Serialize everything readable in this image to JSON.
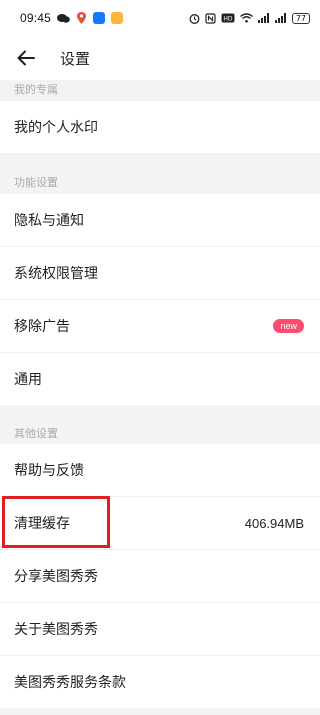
{
  "status_bar": {
    "time": "09:45",
    "battery": "77"
  },
  "header": {
    "title": "设置"
  },
  "sections": {
    "my_exclusive": "我的专属",
    "features": "功能设置",
    "others": "其他设置"
  },
  "rows": {
    "watermark": "我的个人水印",
    "privacy": "隐私与通知",
    "permissions": "系统权限管理",
    "remove_ads": "移除广告",
    "remove_ads_badge": "new",
    "general": "通用",
    "help": "帮助与反馈",
    "clear_cache": "清理缓存",
    "cache_size": "406.94MB",
    "share": "分享美图秀秀",
    "about": "关于美图秀秀",
    "terms": "美图秀秀服务条款"
  },
  "colors": {
    "badge": "#fc4d6e",
    "highlight_box": "#e02020"
  }
}
